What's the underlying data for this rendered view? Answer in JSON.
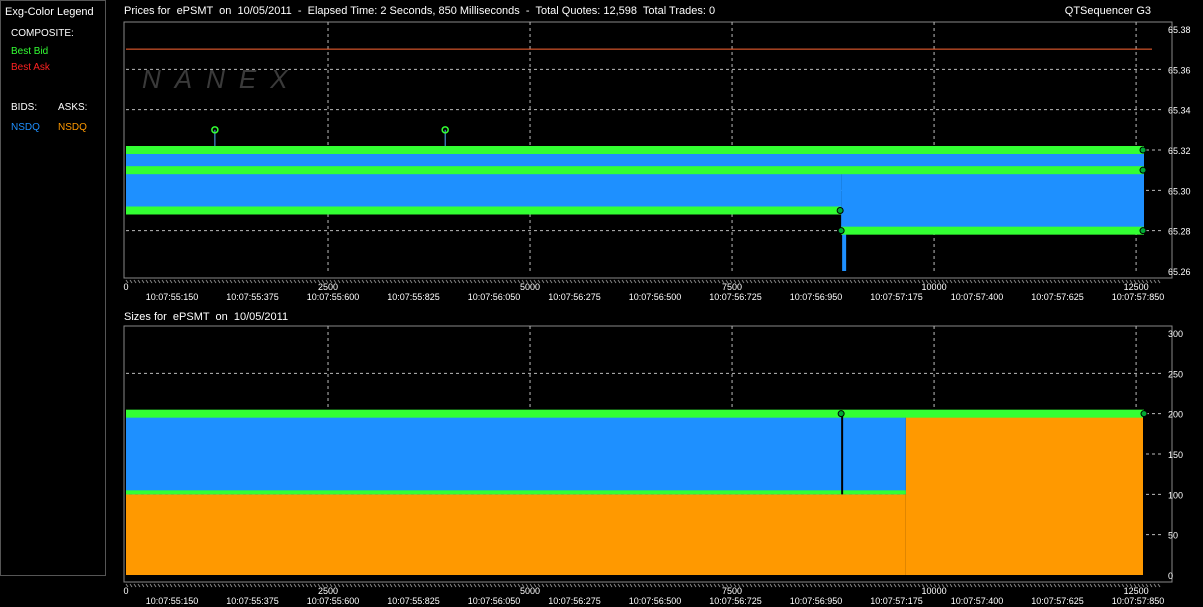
{
  "legend": {
    "title": "Exg-Color Legend",
    "composite_label": "COMPOSITE:",
    "best_bid": "Best Bid",
    "best_ask": "Best Ask",
    "bids_label": "BIDS:",
    "asks_label": "ASKS:",
    "bid_exchange": "NSDQ",
    "ask_exchange": "NSDQ",
    "colors": {
      "best_bid": "#33ff33",
      "best_ask": "#ff2222",
      "bid_nsdq": "#1e90ff",
      "ask_nsdq": "#ff9900"
    }
  },
  "header": {
    "prices_title": "Prices for  ePSMT  on  10/05/2011  -  Elapsed Time: 2 Seconds, 850 Milliseconds  -  Total Quotes: 12,598  Total Trades: 0",
    "app_name": "QTSequencer G3",
    "sizes_title": "Sizes for  ePSMT  on  10/05/2011"
  },
  "watermark": "NANEX",
  "chart_data": [
    {
      "type": "line",
      "title": "Prices for ePSMT on 10/05/2011",
      "xlim": [
        0,
        12598
      ],
      "ylim": [
        65.26,
        65.38
      ],
      "y_ticks": [
        "65.38",
        "65.36",
        "65.34",
        "65.32",
        "65.30",
        "65.28",
        "65.26"
      ],
      "x_ticks": [
        "0",
        "2500",
        "5000",
        "7500",
        "10000",
        "12500"
      ],
      "time_labels": [
        "10:07:55:150",
        "10:07:55:375",
        "10:07:55:600",
        "10:07:55:825",
        "10:07:56:050",
        "10:07:56:275",
        "10:07:56:500",
        "10:07:56:725",
        "10:07:56:950",
        "10:07:57:175",
        "10:07:57:400",
        "10:07:57:625",
        "10:07:57:850"
      ],
      "best_ask": [
        {
          "x": 0,
          "y": 65.37
        },
        {
          "x": 12598,
          "y": 65.37
        }
      ],
      "best_bid_levels": [
        {
          "x0": 0,
          "x1": 12598,
          "y": 65.32
        },
        {
          "x0": 0,
          "x1": 12598,
          "y": 65.31
        },
        {
          "x0": 0,
          "x1": 8850,
          "y": 65.29
        },
        {
          "x0": 8850,
          "x1": 12598,
          "y": 65.28
        }
      ],
      "bid_bands": [
        {
          "x0": 0,
          "x1": 12598,
          "y0": 65.31,
          "y1": 65.32
        },
        {
          "x0": 0,
          "x1": 8850,
          "y0": 65.29,
          "y1": 65.31
        },
        {
          "x0": 8850,
          "x1": 12598,
          "y0": 65.28,
          "y1": 65.31
        }
      ],
      "markers": [
        {
          "x": 1100,
          "y": 65.33
        },
        {
          "x": 3950,
          "y": 65.33
        }
      ]
    },
    {
      "type": "area",
      "title": "Sizes for ePSMT on 10/05/2011",
      "xlim": [
        0,
        12598
      ],
      "ylim": [
        0,
        300
      ],
      "y_ticks": [
        "300",
        "250",
        "200",
        "150",
        "100",
        "50",
        "0"
      ],
      "x_ticks": [
        "0",
        "2500",
        "5000",
        "7500",
        "10000",
        "12500"
      ],
      "series": [
        {
          "name": "NSDQ Ask Size",
          "points": [
            {
              "x0": 0,
              "x1": 9650,
              "value": 100
            },
            {
              "x0": 9650,
              "x1": 12598,
              "value": 200
            }
          ]
        },
        {
          "name": "NSDQ Bid Size",
          "points": [
            {
              "x0": 0,
              "x1": 9650,
              "value": 200
            }
          ]
        },
        {
          "name": "Best Bid Size",
          "points": [
            {
              "x0": 0,
              "x1": 12598,
              "value": 200
            },
            {
              "x0": 0,
              "x1": 9650,
              "value": 100
            }
          ]
        }
      ]
    }
  ]
}
